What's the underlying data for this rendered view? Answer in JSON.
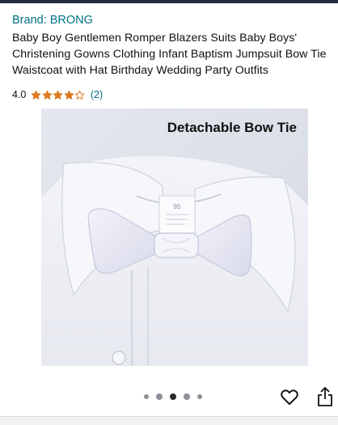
{
  "product": {
    "brand": "Brand: BRONG",
    "title": "Baby Boy Gentlemen Romper Blazers Suits Baby Boys' Christening Gowns Clothing Infant Baptism Jumpsuit Bow Tie Waistcoat with Hat Birthday Wedding Party Outfits",
    "rating_value": "4.0",
    "rating_stars": 4,
    "rating_max": 5,
    "review_count": "(2)"
  },
  "gallery": {
    "image_caption": "Detachable Bow Tie",
    "tag_text": "95",
    "image_count": 5,
    "active_index": 2
  },
  "actions": {
    "favorite_icon": "heart-icon",
    "share_icon": "share-icon"
  },
  "colors": {
    "link": "#007185",
    "star": "#de7921",
    "text": "#0f1111",
    "dot_active": "#2b2b2b",
    "dot_inactive": "#8d9096"
  }
}
